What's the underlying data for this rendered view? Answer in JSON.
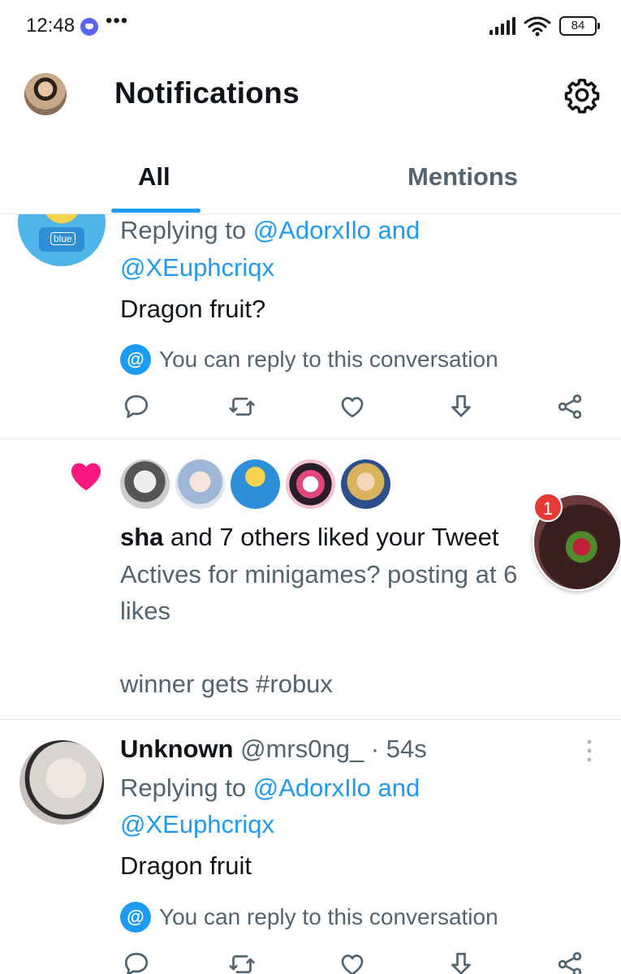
{
  "status_bar": {
    "time": "12:48",
    "dots": "•••",
    "battery": "84"
  },
  "header": {
    "title": "Notifications"
  },
  "tabs": [
    {
      "label": "All",
      "selected": true
    },
    {
      "label": "Mentions",
      "selected": false
    }
  ],
  "notifications": [
    {
      "type": "reply",
      "replying_prefix": "Replying to",
      "replying_handles": "@AdorxIlo and",
      "replying_handles_2": "@XEuphcriqx",
      "text": "Dragon fruit?",
      "reply_note": "You can reply to this conversation"
    },
    {
      "type": "like",
      "actor": "sha",
      "summary_rest": " and 7 others liked your Tweet",
      "tweet_line1": "Actives for minigames? posting at 6",
      "tweet_line2": "likes",
      "tweet_line3": "winner gets #robux"
    },
    {
      "type": "reply",
      "author_name": "Unknown",
      "author_handle": "@mrs0ng_",
      "time": "· 54s",
      "replying_prefix": "Replying to",
      "replying_handles": "@AdorxIlo and",
      "replying_handles_2": "@XEuphcriqx",
      "text": "Dragon fruit",
      "reply_note": "You can reply to this conversation"
    }
  ],
  "chat_bubble": {
    "badge_count": "1"
  },
  "colors": {
    "accent": "#1d9bf0",
    "like_pink": "#f91880",
    "text_primary": "#0f1419",
    "text_secondary": "#536471"
  },
  "icons": [
    "reply-icon",
    "retweet-icon",
    "like-icon",
    "bookmark-download-icon",
    "share-icon",
    "settings-gear-icon",
    "heart-icon",
    "more-options-icon"
  ]
}
